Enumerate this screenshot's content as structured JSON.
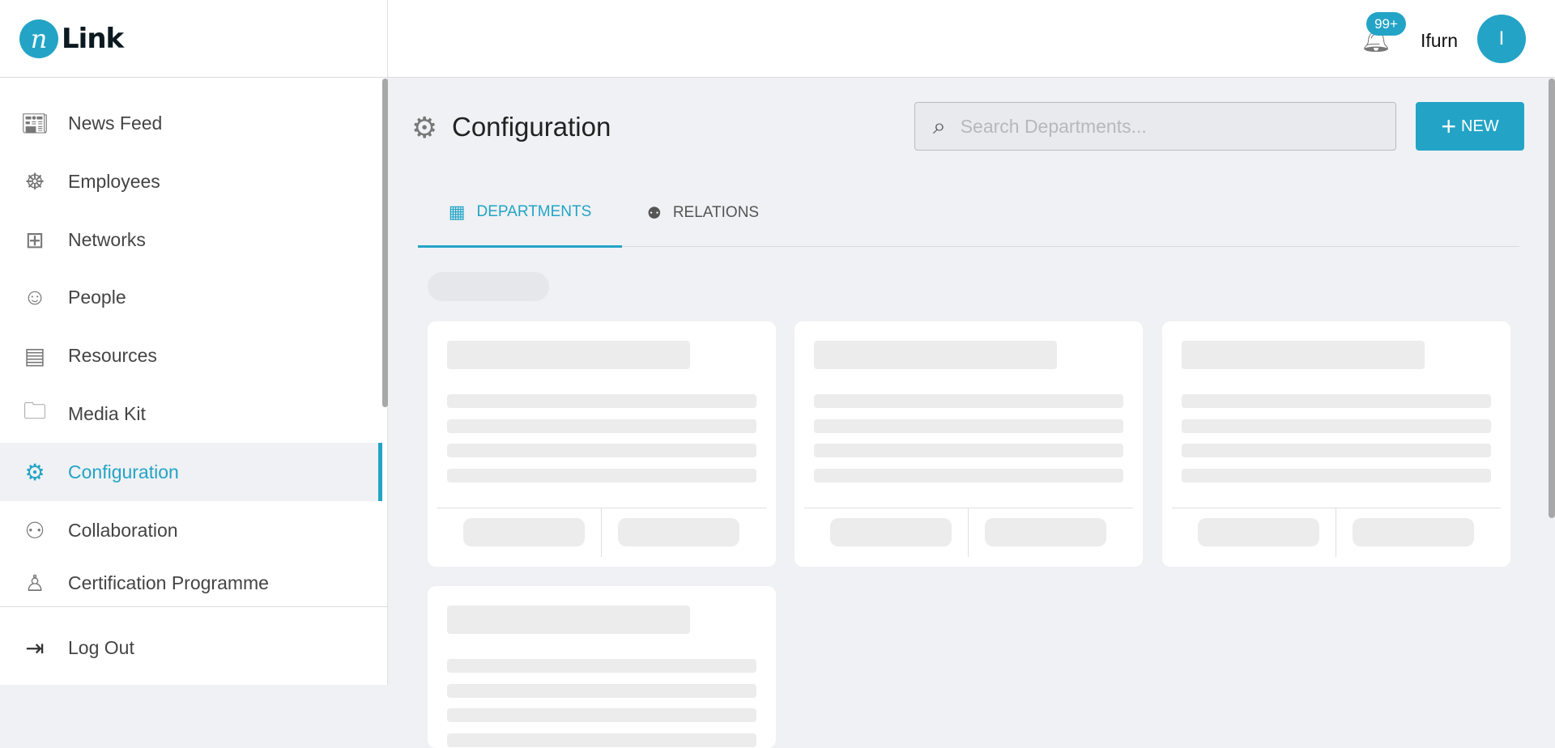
{
  "app": {
    "logo_mark": "n",
    "logo_text": "Link"
  },
  "header": {
    "notification_count": "99+",
    "user_name": "Ifurn",
    "avatar_initial": "I"
  },
  "sidebar": {
    "items": [
      {
        "label": "News Feed",
        "icon": "newspaper-icon"
      },
      {
        "label": "Employees",
        "icon": "employees-icon"
      },
      {
        "label": "Networks",
        "icon": "network-icon"
      },
      {
        "label": "People",
        "icon": "people-icon"
      },
      {
        "label": "Resources",
        "icon": "book-icon"
      },
      {
        "label": "Media Kit",
        "icon": "folder-icon"
      },
      {
        "label": "Configuration",
        "icon": "gear-icon",
        "active": true
      },
      {
        "label": "Collaboration",
        "icon": "collaboration-icon"
      },
      {
        "label": "Certification Programme",
        "icon": "certification-icon"
      }
    ],
    "logout": "Log Out"
  },
  "main": {
    "title": "Configuration",
    "search_placeholder": "Search Departments...",
    "new_label": "NEW",
    "tabs": [
      {
        "label": "DEPARTMENTS",
        "active": true
      },
      {
        "label": "RELATIONS"
      }
    ]
  },
  "colors": {
    "accent": "#23a4c6"
  }
}
